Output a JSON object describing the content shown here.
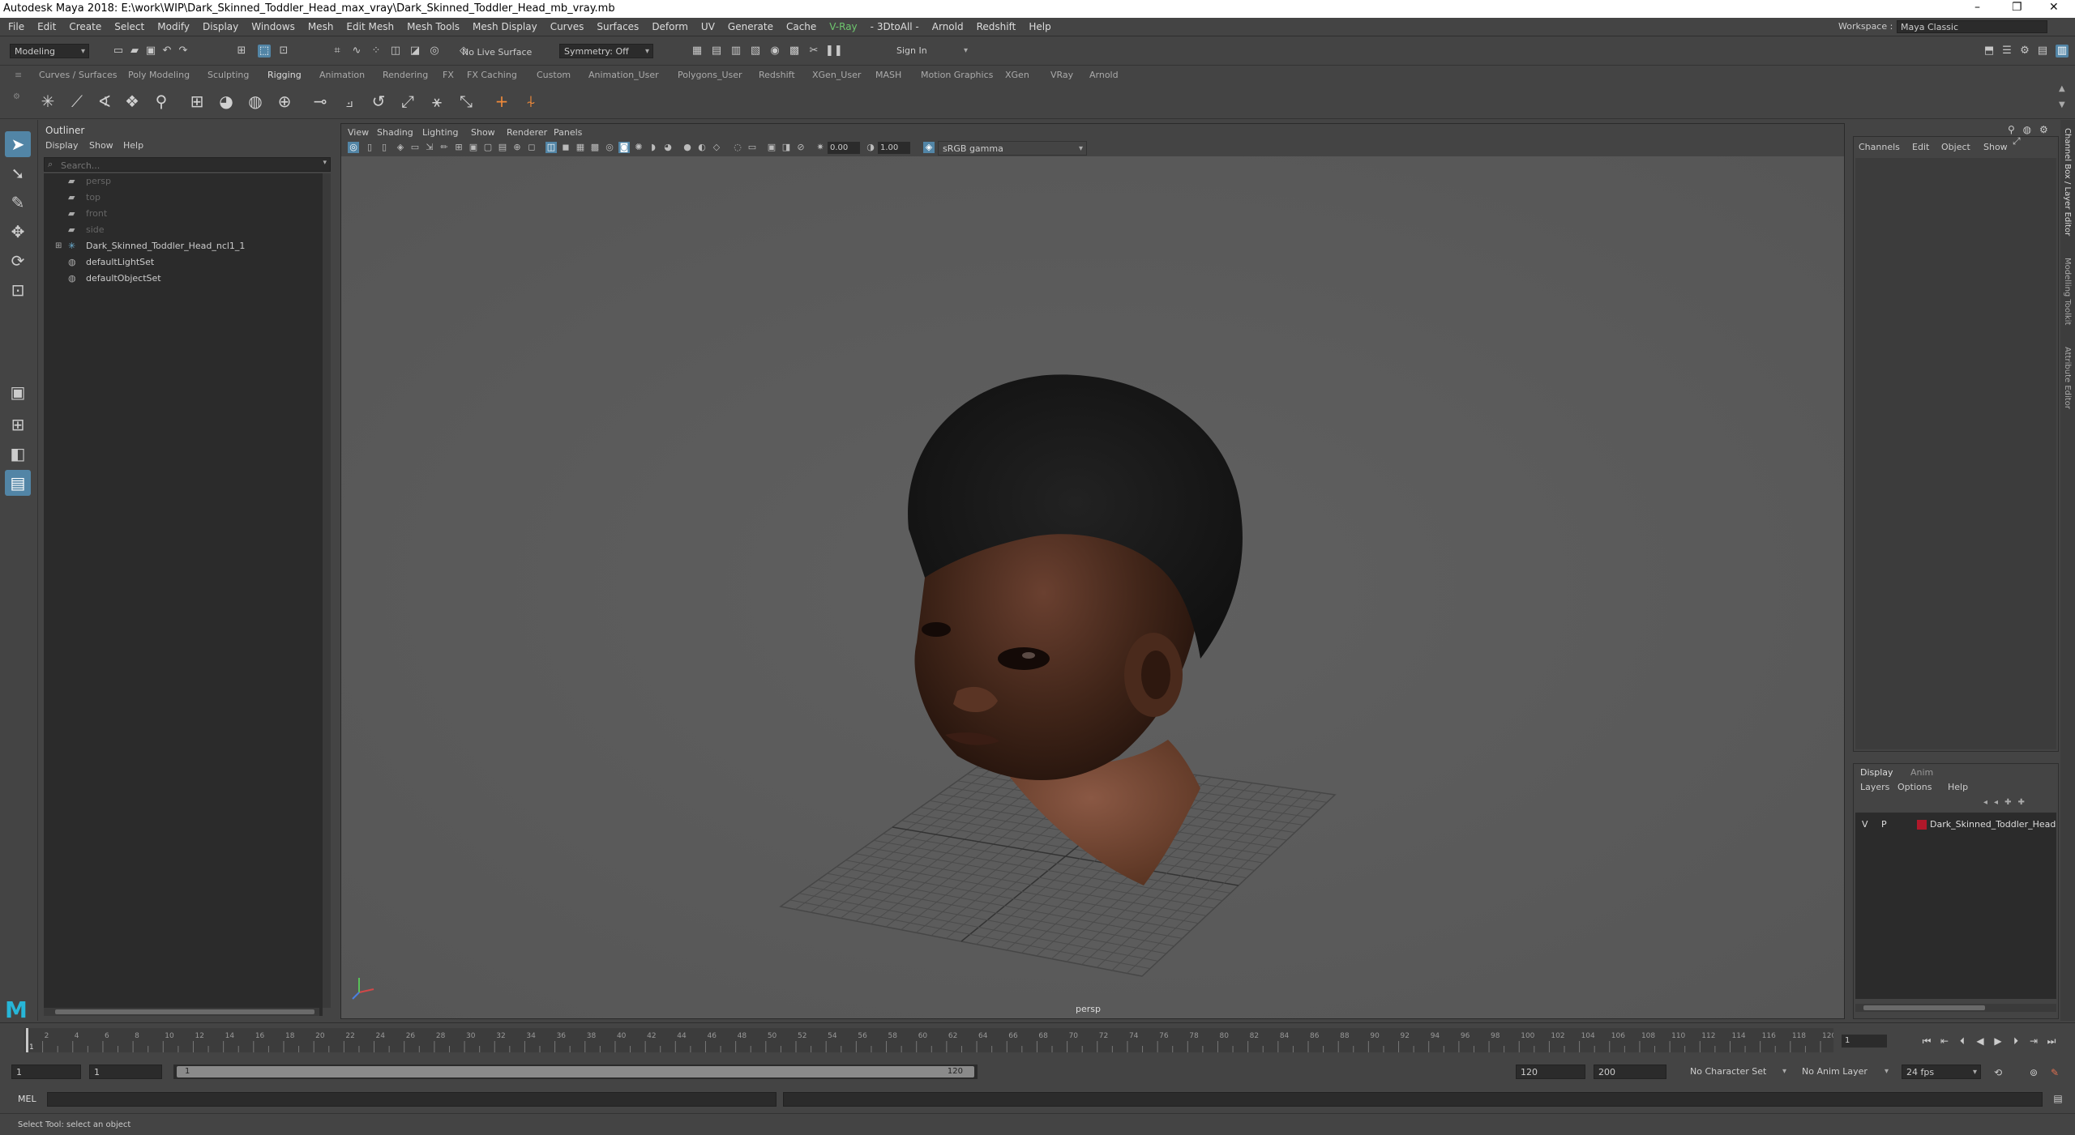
{
  "window": {
    "title": "Autodesk Maya 2018: E:\\work\\WIP\\Dark_Skinned_Toddler_Head_max_vray\\Dark_Skinned_Toddler_Head_mb_vray.mb",
    "minimize": "–",
    "restore": "❐",
    "close": "✕"
  },
  "menubar": {
    "items": [
      "File",
      "Edit",
      "Create",
      "Select",
      "Modify",
      "Display",
      "Windows",
      "Mesh",
      "Edit Mesh",
      "Mesh Tools",
      "Mesh Display",
      "Curves",
      "Surfaces",
      "Deform",
      "UV",
      "Generate",
      "Cache",
      "V-Ray",
      "- 3DtoAll -",
      "Arnold",
      "Redshift",
      "Help"
    ],
    "workspace_label": "Workspace :",
    "workspace_value": "Maya Classic"
  },
  "statusline": {
    "mode": "Modeling",
    "live_surface": "No Live Surface",
    "symmetry": "Symmetry: Off",
    "sign_in": "Sign In"
  },
  "shelf": {
    "tabs": [
      "Curves / Surfaces",
      "Poly Modeling",
      "Sculpting",
      "Rigging",
      "Animation",
      "Rendering",
      "FX",
      "FX Caching",
      "Custom",
      "Animation_User",
      "Polygons_User",
      "Redshift",
      "XGen_User",
      "MASH",
      "Motion Graphics",
      "XGen",
      "VRay",
      "Arnold"
    ],
    "active_tab": "Rigging"
  },
  "outliner": {
    "title": "Outliner",
    "menu": [
      "Display",
      "Show",
      "Help"
    ],
    "search_placeholder": "Search...",
    "items": [
      {
        "label": "persp",
        "icon": "camera-icon",
        "dim": true
      },
      {
        "label": "top",
        "icon": "camera-icon",
        "dim": true
      },
      {
        "label": "front",
        "icon": "camera-icon",
        "dim": true
      },
      {
        "label": "side",
        "icon": "camera-icon",
        "dim": true
      },
      {
        "label": "Dark_Skinned_Toddler_Head_ncl1_1",
        "icon": "joint-icon",
        "dim": false,
        "expandable": true
      },
      {
        "label": "defaultLightSet",
        "icon": "set-icon",
        "dim": false
      },
      {
        "label": "defaultObjectSet",
        "icon": "set-icon",
        "dim": false
      }
    ]
  },
  "viewport": {
    "menu": [
      "View",
      "Shading",
      "Lighting",
      "Show",
      "Renderer",
      "Panels"
    ],
    "exposure": "0.00",
    "gamma": "1.00",
    "color_space": "sRGB gamma",
    "camera": "persp"
  },
  "channelbox": {
    "menu": [
      "Channels",
      "Edit",
      "Object",
      "Show"
    ]
  },
  "layers": {
    "tabs": [
      "Display",
      "Anim"
    ],
    "active_tab": "Display",
    "menu": [
      "Layers",
      "Options",
      "Help"
    ],
    "rows": [
      {
        "v": "V",
        "p": "P",
        "color": "#b0182a",
        "name": "Dark_Skinned_Toddler_Head"
      }
    ]
  },
  "sidebar_tabs": [
    "Channel Box / Layer Editor",
    "Modelling Toolkit",
    "Attribute Editor"
  ],
  "timeline": {
    "ticks": [
      "1",
      "2",
      "4",
      "6",
      "8",
      "10",
      "12",
      "14",
      "16",
      "18",
      "20",
      "22",
      "24",
      "26",
      "28",
      "30",
      "32",
      "34",
      "36",
      "38",
      "40",
      "42",
      "44",
      "46",
      "48",
      "50",
      "52",
      "54",
      "56",
      "58",
      "60",
      "62",
      "64",
      "66",
      "68",
      "70",
      "72",
      "74",
      "76",
      "78",
      "80",
      "82",
      "84",
      "86",
      "88",
      "90",
      "92",
      "94",
      "96",
      "98",
      "100",
      "102",
      "104",
      "106",
      "108",
      "110",
      "112",
      "114",
      "116",
      "118",
      "120"
    ],
    "current_frame": "1"
  },
  "range": {
    "start": "1",
    "start_inner": "1",
    "thumb_start": "1",
    "thumb_end": "120",
    "end_inner": "120",
    "end": "200",
    "character_set": "No Character Set",
    "anim_layer": "No Anim Layer",
    "fps": "24 fps"
  },
  "commandline": {
    "label": "MEL"
  },
  "helpline": {
    "text": "Select Tool: select an object"
  },
  "logo": "M"
}
